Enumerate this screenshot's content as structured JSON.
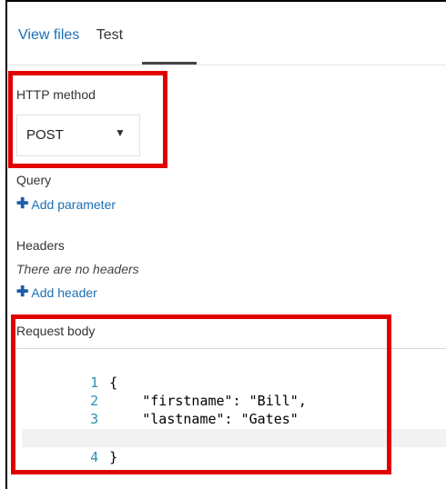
{
  "tabs": [
    {
      "label": "View files"
    },
    {
      "label": "Test"
    }
  ],
  "http_method": {
    "label": "HTTP method",
    "selected": "POST"
  },
  "query": {
    "label": "Query",
    "add_label": "Add parameter"
  },
  "headers": {
    "label": "Headers",
    "empty_text": "There are no headers",
    "add_label": "Add header"
  },
  "request_body": {
    "label": "Request body",
    "lines": [
      {
        "num": "1",
        "text": "{"
      },
      {
        "num": "2",
        "text": "    \"firstname\": \"Bill\","
      },
      {
        "num": "3",
        "text": "    \"lastname\": \"Gates\""
      },
      {
        "num": "4",
        "text": "}"
      }
    ]
  },
  "colors": {
    "link": "#1e6fb3",
    "highlight_box": "#e00000",
    "line_number": "#2b91af"
  }
}
